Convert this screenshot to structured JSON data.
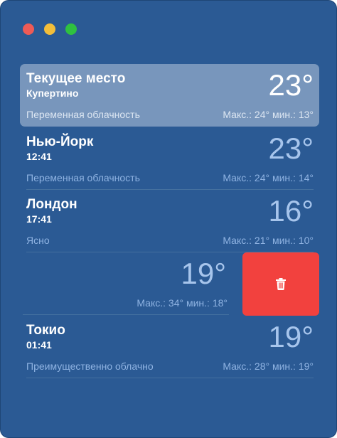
{
  "window": {
    "controls": [
      "close",
      "minimize",
      "zoom"
    ]
  },
  "locations": [
    {
      "city": "Текущее место",
      "sub": "Купертино",
      "temp": "23°",
      "condition": "Переменная облачность",
      "range": "Макс.: 24° мин.: 13°"
    },
    {
      "city": "Нью-Йорк",
      "sub": "12:41",
      "temp": "23°",
      "condition": "Переменная облачность",
      "range": "Макс.: 24° мин.: 14°"
    },
    {
      "city": "Лондон",
      "sub": "17:41",
      "temp": "16°",
      "condition": "Ясно",
      "range": "Макс.: 21° мин.: 10°"
    },
    {
      "temp": "19°",
      "range": "Макс.: 34° мин.: 18°"
    },
    {
      "city": "Токио",
      "sub": "01:41",
      "temp": "19°",
      "condition": "Преимущественно облачно",
      "range": "Макс.: 28° мин.: 19°"
    }
  ],
  "delete_action": {
    "icon": "trash-icon",
    "color": "#f2413e"
  },
  "colors": {
    "background": "#2b5a94",
    "selected": "#7896bc",
    "muted_text": "#8fb3e2"
  }
}
